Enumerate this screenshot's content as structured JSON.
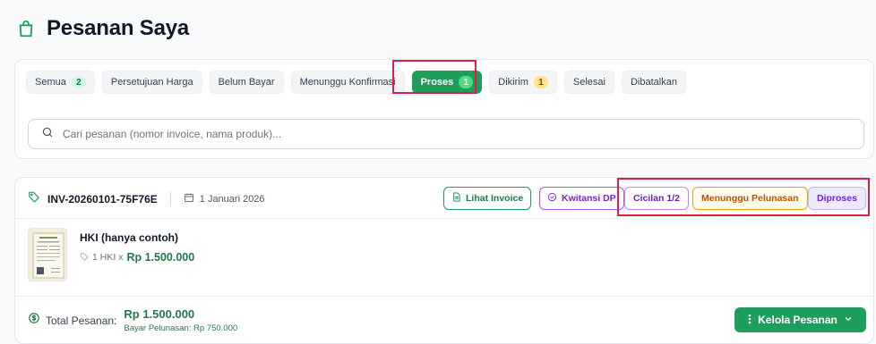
{
  "page": {
    "title": "Pesanan Saya",
    "title_icon": "shopping-bag-icon"
  },
  "tabs": [
    {
      "label": "Semua",
      "count": "2",
      "count_color": "green"
    },
    {
      "label": "Persetujuan Harga"
    },
    {
      "label": "Belum Bayar"
    },
    {
      "label": "Menunggu Konfirmasi"
    },
    {
      "label": "Proses",
      "count": "1",
      "active": true
    },
    {
      "label": "Dikirim",
      "count": "1",
      "count_color": "orange"
    },
    {
      "label": "Selesai"
    },
    {
      "label": "Dibatalkan"
    }
  ],
  "search": {
    "placeholder": "Cari pesanan (nomor invoice, nama produk)...",
    "value": ""
  },
  "order": {
    "invoice_number": "INV-20260101-75F76E",
    "date": "1 Januari 2026",
    "actions": {
      "invoice_label": "Lihat Invoice",
      "receipt_label": "Kwitansi DP"
    },
    "badges": {
      "installment": "Cicilan 1/2",
      "waiting": "Menunggu Pelunasan",
      "status": "Diproses"
    },
    "item": {
      "name": "HKI (hanya contoh)",
      "qty": "1 HKI x",
      "price": "Rp 1.500.000"
    },
    "footer": {
      "total_label": "Total Pesanan:",
      "total_value": "Rp 1.500.000",
      "remaining_label": "Bayar Pelunasan: Rp 750.000",
      "manage_label": "Kelola Pesanan"
    }
  },
  "colors": {
    "primary_green": "#1f9d5c",
    "highlight_red": "#e11d48",
    "purple": "#a855f7",
    "amber": "#f59e0b"
  }
}
